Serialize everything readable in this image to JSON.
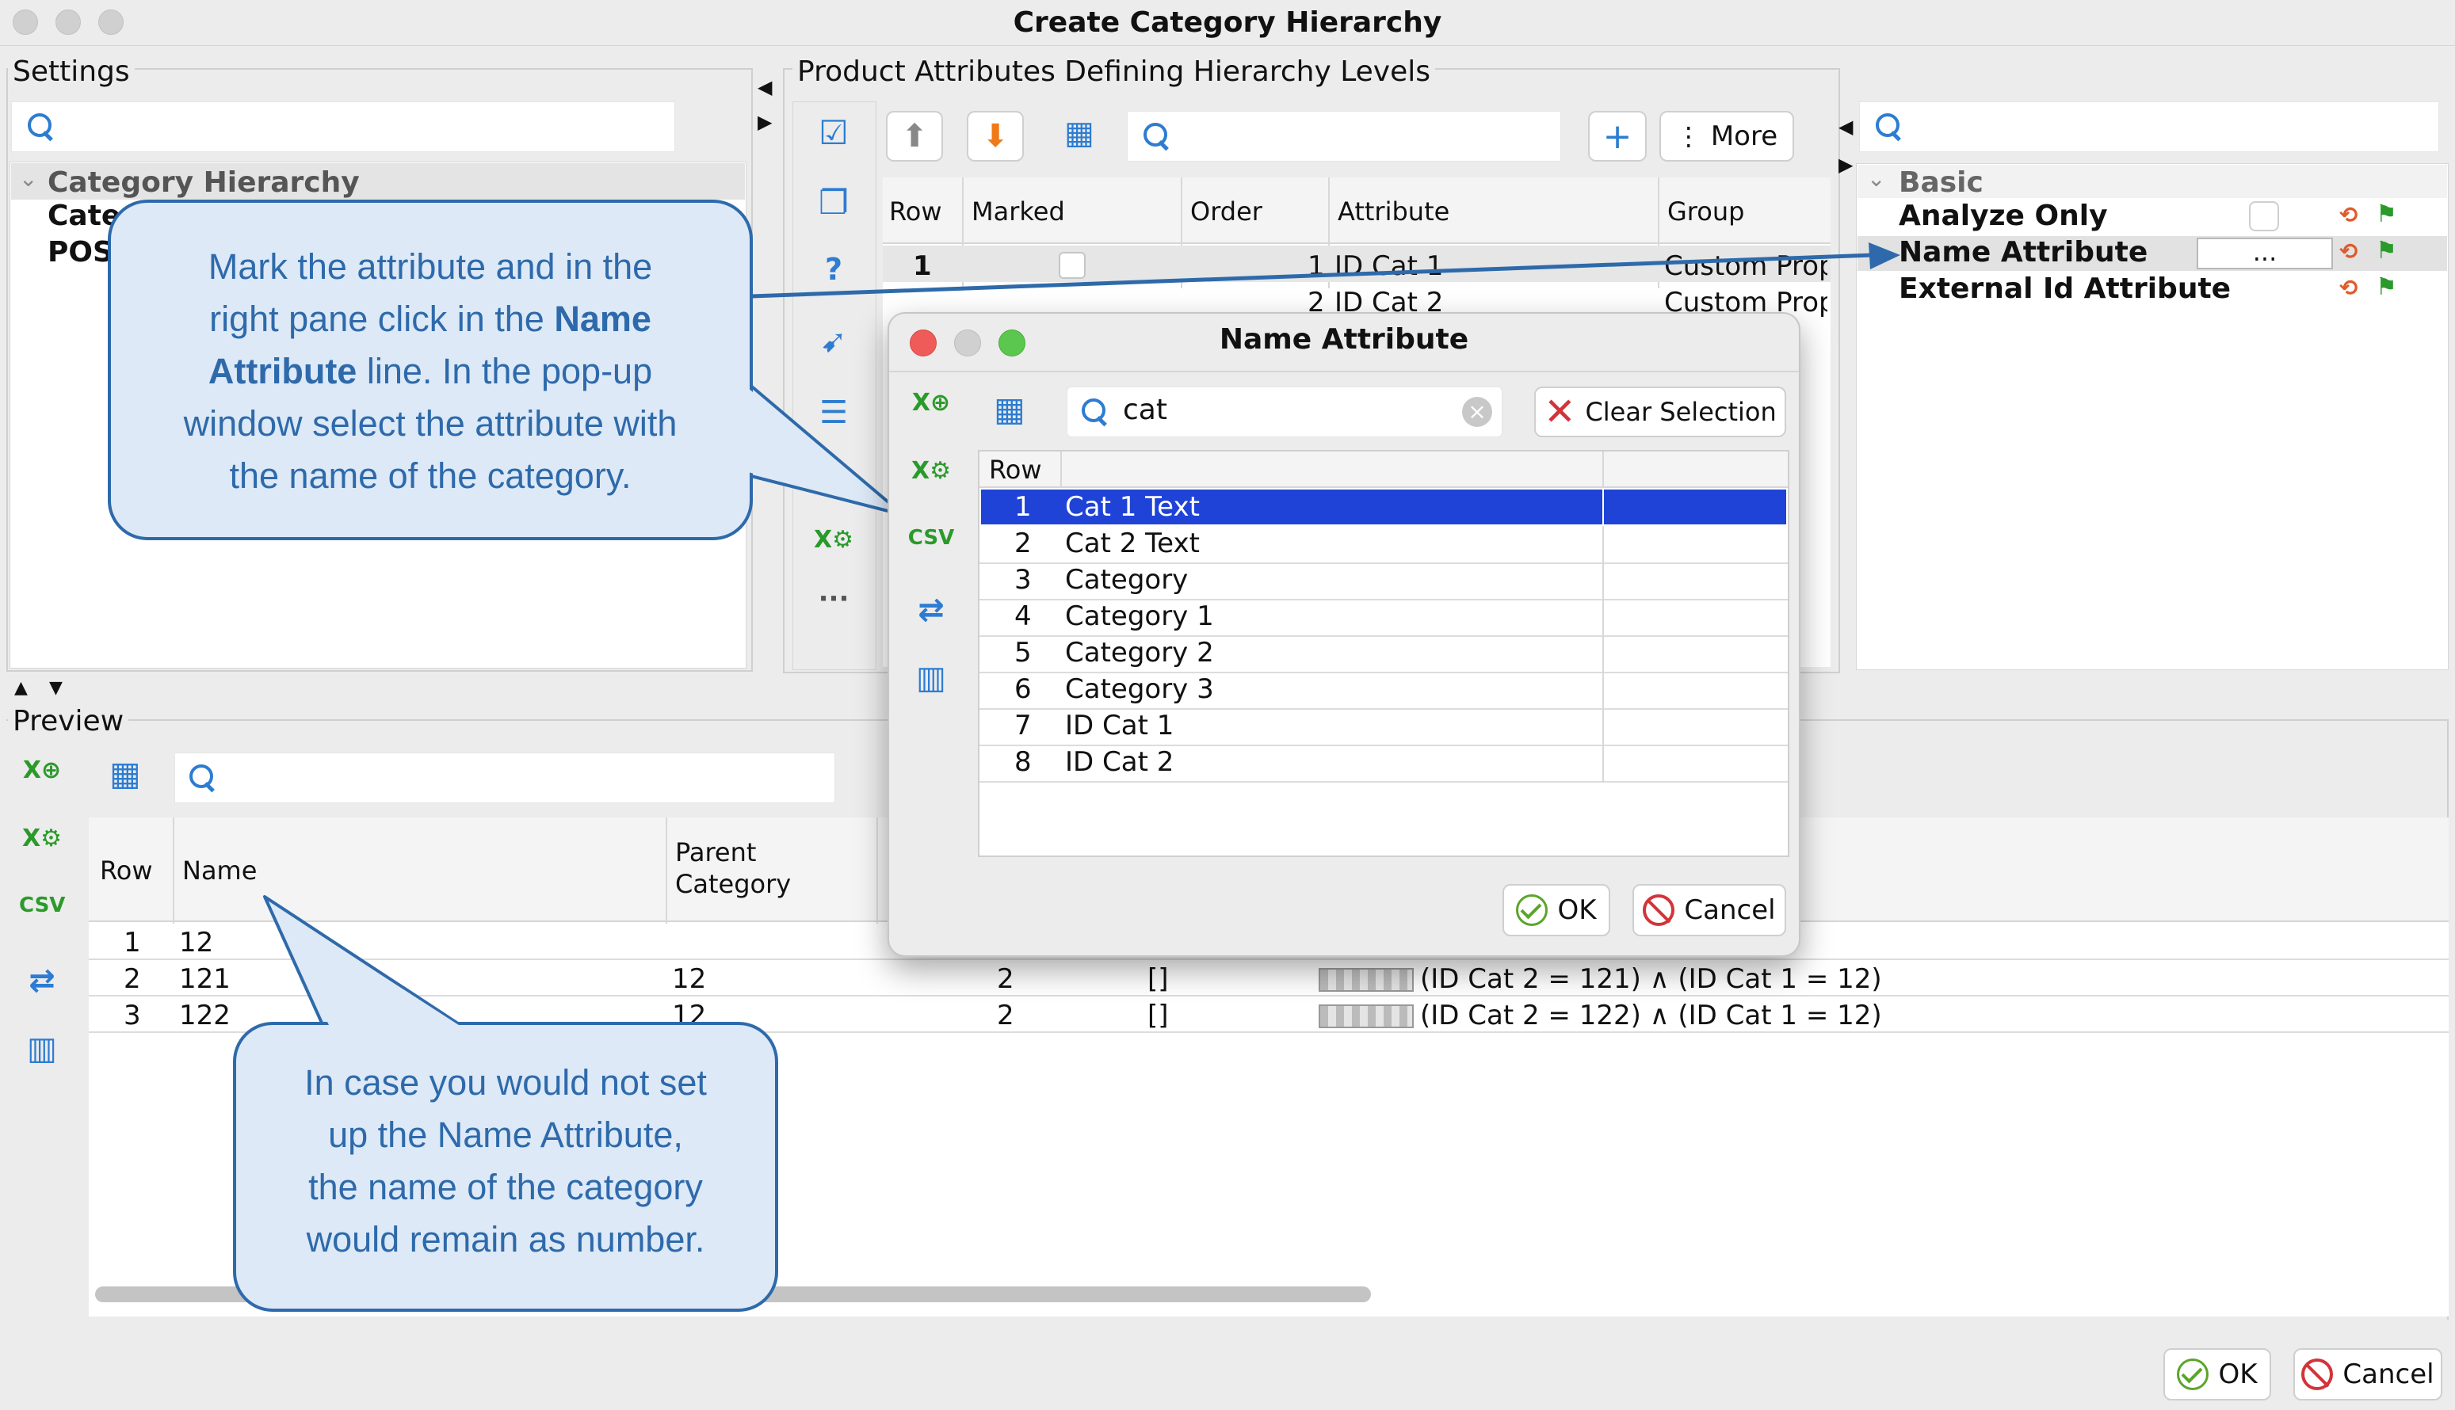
{
  "window": {
    "title": "Create Category Hierarchy"
  },
  "settings": {
    "label": "Settings",
    "tree_root": "Category Hierarchy",
    "tree_items": [
      "Cate",
      "POS"
    ]
  },
  "attributes": {
    "label": "Product Attributes Defining Hierarchy Levels",
    "more_label": "More",
    "columns": [
      "Row",
      "Marked",
      "Order",
      "Attribute",
      "Group"
    ],
    "rows": [
      {
        "row": "1",
        "order": "1",
        "attribute": "ID Cat 1",
        "group": "Custom Prop"
      },
      {
        "row": "2",
        "order": "2",
        "attribute": "ID Cat 2",
        "group": "Custom Prop"
      }
    ]
  },
  "properties": {
    "section": "Basic",
    "items": [
      {
        "name": "Analyze Only",
        "value": ""
      },
      {
        "name": "Name Attribute",
        "value": "..."
      },
      {
        "name": "External Id Attribute",
        "value": ""
      }
    ]
  },
  "preview": {
    "label": "Preview",
    "columns": [
      "Row",
      "Name",
      "Parent Category"
    ],
    "rows": [
      {
        "row": "1",
        "name": "12",
        "parent": "",
        "level": "",
        "list": "",
        "rule": ""
      },
      {
        "row": "2",
        "name": "121",
        "parent": "12",
        "level": "2",
        "list": "[]",
        "rule": "(ID Cat 2 = 121) ∧ (ID Cat 1 = 12)"
      },
      {
        "row": "3",
        "name": "122",
        "parent": "12",
        "level": "2",
        "list": "[]",
        "rule": "(ID Cat 2 = 122) ∧ (ID Cat 1 = 12)"
      }
    ]
  },
  "dialog": {
    "title": "Name Attribute",
    "search_value": "cat",
    "clear_label": "Clear Selection",
    "column_row": "Row",
    "rows": [
      {
        "row": "1",
        "name": "Cat 1 Text",
        "selected": true
      },
      {
        "row": "2",
        "name": "Cat 2 Text"
      },
      {
        "row": "3",
        "name": "Category"
      },
      {
        "row": "4",
        "name": "Category 1"
      },
      {
        "row": "5",
        "name": "Category 2"
      },
      {
        "row": "6",
        "name": "Category 3"
      },
      {
        "row": "7",
        "name": "ID Cat 1"
      },
      {
        "row": "8",
        "name": "ID Cat 2"
      }
    ],
    "ok_label": "OK",
    "cancel_label": "Cancel"
  },
  "footer": {
    "ok_label": "OK",
    "cancel_label": "Cancel"
  },
  "callouts": {
    "top_l1": "Mark the attribute and in the",
    "top_l2a": "right pane click in the ",
    "top_l2b": "Name",
    "top_l3a": "Attribute",
    "top_l3b": " line. In the pop-up",
    "top_l4": "window select the attribute with",
    "top_l5": "the name of the category.",
    "bottom_l1": "In case you would not set",
    "bottom_l2": "up the Name Attribute,",
    "bottom_l3": "the name of the category",
    "bottom_l4": "would remain as number."
  },
  "colors": {
    "accent": "#2e6aab",
    "selection": "#1f43d6",
    "callout_bg": "#dde9f6"
  }
}
